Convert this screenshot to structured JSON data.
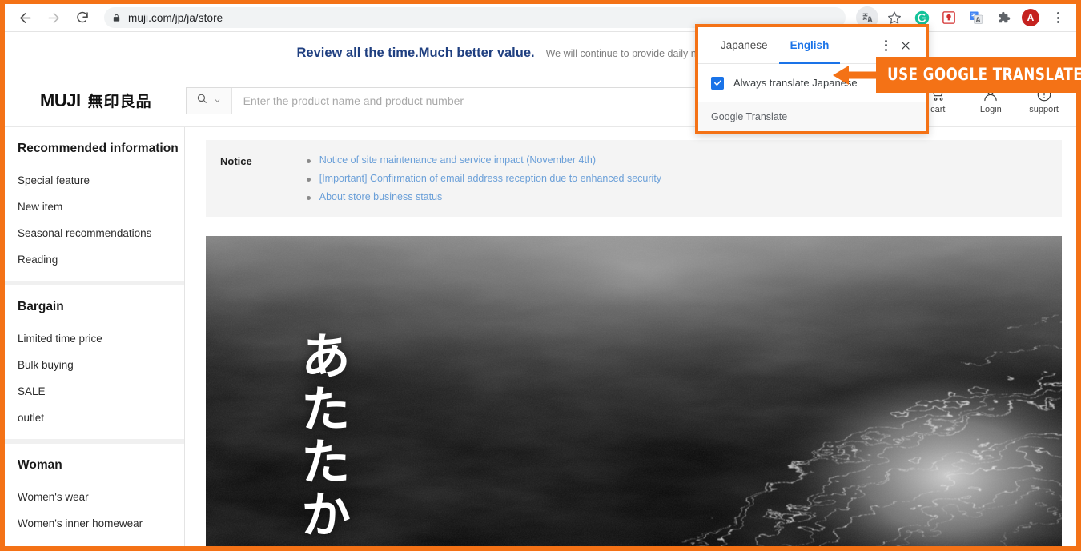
{
  "browser": {
    "url_prefix": "muji.com",
    "url_path": "/jp/ja/store",
    "url_full": "muji.com/jp/ja/store",
    "back_icon": "back-arrow-icon",
    "forward_icon": "forward-arrow-icon",
    "reload_icon": "reload-icon",
    "lock_icon": "lock-icon",
    "toolbar_icons": [
      "translate-toolbar-icon",
      "bookmark-star-icon",
      "grammarly-extension-icon",
      "lastpass-extension-icon",
      "google-translate-extension-icon",
      "extensions-puzzle-icon"
    ],
    "avatar_letter": "A",
    "menu_icon": "three-dot-menu-icon"
  },
  "translate_popup": {
    "tabs": [
      {
        "label": "Japanese",
        "active": false
      },
      {
        "label": "English",
        "active": true
      }
    ],
    "checkbox_label": "Always translate Japanese",
    "checkbox_checked": true,
    "footer_label": "Google Translate",
    "kebab_icon": "three-dot-menu-icon",
    "close_icon": "close-icon",
    "accent_color": "#1a73e8",
    "highlight_color": "#f47216"
  },
  "annotation": {
    "banner_text": "USE GOOGLE TRANSLATE!",
    "arrow_icon": "left-arrow-icon",
    "color": "#f47216"
  },
  "promo": {
    "title": "Review all the time.Much better value.",
    "subtitle": "We will continue to provide daily necessities that supp",
    "title_color": "#1f3f80"
  },
  "header": {
    "logo_latin": "MUJI",
    "logo_japanese": "無印良品",
    "search": {
      "placeholder": "Enter the product name and product number",
      "value": "",
      "mode_icon": "search-icon",
      "dropdown_icon": "chevron-down-icon"
    },
    "actions": [
      {
        "label": "cart",
        "icon": "shopping-cart-icon"
      },
      {
        "label": "Login",
        "icon": "user-person-icon"
      },
      {
        "label": "support",
        "icon": "exclamation-circle-icon"
      }
    ]
  },
  "sidebar": {
    "groups": [
      {
        "title": "Recommended information",
        "items": [
          "Special feature",
          "New item",
          "Seasonal recommendations",
          "Reading"
        ]
      },
      {
        "title": "Bargain",
        "items": [
          "Limited time price",
          "Bulk buying",
          "SALE",
          "outlet"
        ]
      },
      {
        "title": "Woman",
        "items": [
          "Women's wear",
          "Women's inner homewear"
        ]
      }
    ]
  },
  "main": {
    "notice": {
      "label": "Notice",
      "links": [
        "Notice of site maintenance and service impact (November 4th)",
        "[Important] Confirmation of email address reception due to enhanced security",
        "About store business status"
      ],
      "link_color": "#6a9fd8"
    },
    "hero": {
      "japanese_text": "あたたか",
      "description": "black-and-white photo of tangled white wool fibers"
    }
  }
}
